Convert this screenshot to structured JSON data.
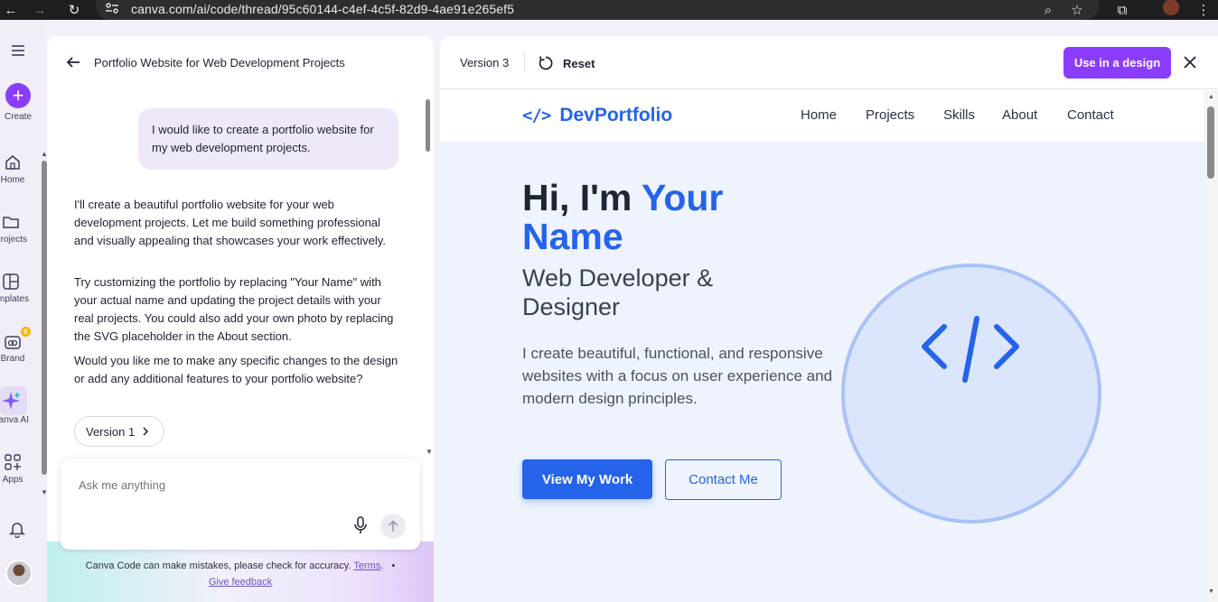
{
  "browser": {
    "url": "canva.com/ai/code/thread/95c60144-c4ef-4c5f-82d9-4ae91e265ef5"
  },
  "rail": {
    "items": [
      {
        "label": "Create",
        "icon": "plus-icon"
      },
      {
        "label": "Home",
        "icon": "home-icon"
      },
      {
        "label": "Projects",
        "icon": "folder-icon"
      },
      {
        "label": "Templates",
        "icon": "templates-icon"
      },
      {
        "label": "Brand",
        "icon": "brand-icon"
      },
      {
        "label": "Canva AI",
        "icon": "sparkle-icon"
      },
      {
        "label": "Apps",
        "icon": "apps-icon"
      }
    ],
    "create_color": "#8b3dff"
  },
  "chat": {
    "title": "Portfolio Website for Web Development Projects",
    "user_message": "I would like to create a portfolio website for my web development projects.",
    "ai_messages": [
      "I'll create a beautiful portfolio website for your web development projects. Let me build something professional and visually appealing that showcases your work effectively.",
      "Try customizing the portfolio by replacing \"Your Name\" with your actual name and updating the project details with your real projects. You could also add your own photo by replacing the SVG placeholder in the About section.",
      "Would you like me to make any specific changes to the design or add any additional features to your portfolio website?"
    ],
    "version_chip": "Version 1",
    "input_placeholder": "Ask me anything",
    "disclaimer": "Canva Code can make mistakes, please check for accuracy.",
    "terms_link": "Terms",
    "bullet": "•",
    "feedback_link": "Give feedback"
  },
  "preview": {
    "version_label": "Version 3",
    "reset_label": "Reset",
    "use_in_design_label": "Use in a design",
    "accent_color": "#8b3dff"
  },
  "site": {
    "logo_mark": "</>",
    "logo_text": "DevPortfolio",
    "nav": [
      "Home",
      "Projects",
      "Skills",
      "About",
      "Contact"
    ],
    "hero_title_prefix": "Hi, I'm ",
    "hero_title_accent": "Your Name",
    "hero_subtitle": "Web Developer & Designer",
    "hero_text": "I create beautiful, functional, and responsive websites with a focus on user experience and modern design principles.",
    "primary_button": "View My Work",
    "secondary_button": "Contact Me",
    "brand_color": "#2563eb"
  }
}
